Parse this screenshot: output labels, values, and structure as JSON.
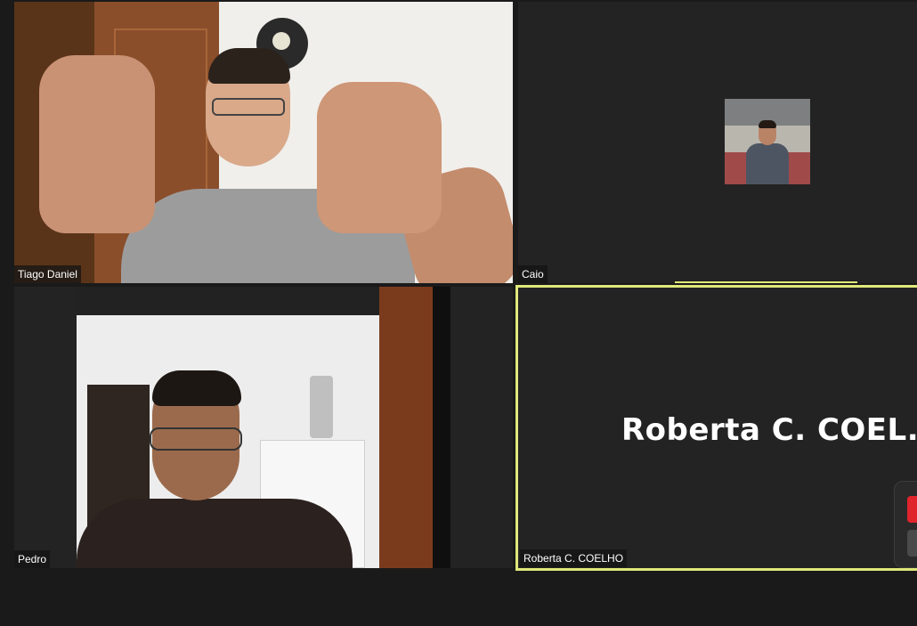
{
  "participants": [
    {
      "name": "Tiago Daniel",
      "video": "on"
    },
    {
      "name": "Caio",
      "video": "off"
    },
    {
      "name": "Pedro",
      "video": "on"
    },
    {
      "name": "Roberta C. COELHO",
      "video": "off",
      "display_name": "Roberta C. COEL...",
      "active_speaker": true
    }
  ],
  "colors": {
    "background": "#1a1a1a",
    "tile_background": "#232323",
    "active_speaker_border": "#dfe87a",
    "control_red": "#e0242b"
  }
}
